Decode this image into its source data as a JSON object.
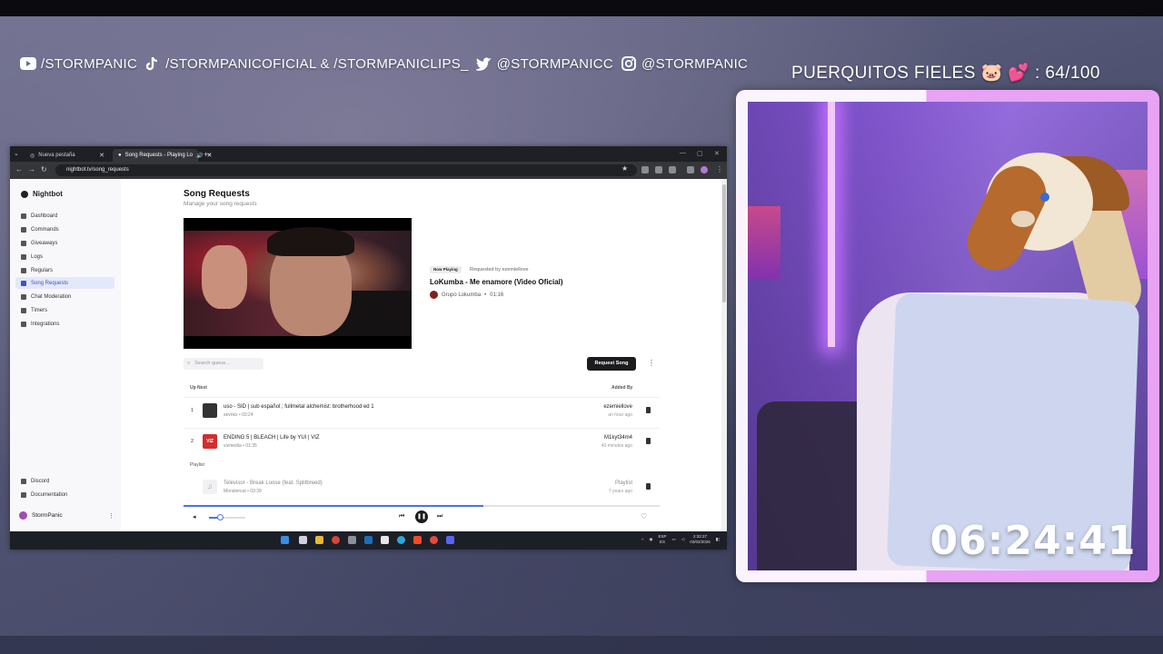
{
  "overlay": {
    "socials": [
      {
        "icon": "youtube-icon",
        "text": "/STORMPANIC"
      },
      {
        "icon": "tiktok-icon",
        "text": "/STORMPANICOFICIAL & /STORMPANICLIPS_"
      },
      {
        "icon": "twitter-icon",
        "text": "@STORMPANICC"
      },
      {
        "icon": "instagram-icon",
        "text": "@STORMPANIC"
      }
    ],
    "goal_text": "PUERQUITOS FIELES 🐷 💕 : 64/100",
    "timer": "06:24:41",
    "colors": {
      "frame_light": "#fbf4ff",
      "frame_pink": "#e8a3f4"
    }
  },
  "browser": {
    "tabs": [
      {
        "label": "Nueva pestaña",
        "active": false
      },
      {
        "label": "Song Requests - Playing Lo",
        "active": true
      }
    ],
    "url": "nightbot.tv/song_requests"
  },
  "sidebar": {
    "brand": "Nightbot",
    "items": [
      {
        "label": "Dashboard",
        "active": false
      },
      {
        "label": "Commands",
        "active": false
      },
      {
        "label": "Giveaways",
        "active": false
      },
      {
        "label": "Logs",
        "active": false
      },
      {
        "label": "Regulars",
        "active": false
      },
      {
        "label": "Song Requests",
        "active": true
      },
      {
        "label": "Chat Moderation",
        "active": false
      },
      {
        "label": "Timers",
        "active": false
      },
      {
        "label": "Integrations",
        "active": false
      }
    ],
    "footer": [
      {
        "label": "Discord"
      },
      {
        "label": "Documentation"
      }
    ],
    "user": "StormPanic"
  },
  "main": {
    "title": "Song Requests",
    "subtitle": "Manage your song requests",
    "now_playing": {
      "badge": "Now Playing",
      "requested_by": "Requested by ezemiellove",
      "title": "LoKumba - Me enamore (Video Oficial)",
      "channel": "Grupo Lokumba",
      "duration": "01:16"
    },
    "search_placeholder": "Search queue...",
    "request_button": "Request Song",
    "headers": {
      "up_next": "Up Next",
      "added_by": "Added By",
      "playlist": "Playlist"
    },
    "queue": [
      {
        "num": "1",
        "title": "uso - SID | sub español ; fullmetal alchemist: brotherhood ed 1",
        "meta": "sevnkx • 03:24",
        "by": "ezemiellove",
        "when": "an hour ago",
        "thumb": ""
      },
      {
        "num": "2",
        "title": "ENDING 5 | BLEACH | Life by YUI | VIZ",
        "meta": "vizmedia • 01:35",
        "by": "M1kyt34m4",
        "when": "40 minutes ago",
        "thumb": "VIZ"
      }
    ],
    "playlist": [
      {
        "title": "Televisor - Break Loose (feat. Splitbreed)",
        "meta": "Monstercat • 03:39",
        "by": "Playlist",
        "when": "7 years ago",
        "thumb": "♫"
      }
    ],
    "playback_progress": 0.63,
    "volume": 0.3
  },
  "taskbar": {
    "lang": "ESP",
    "region": "ES",
    "time": "2:32:27",
    "date": "03/02/2026"
  }
}
